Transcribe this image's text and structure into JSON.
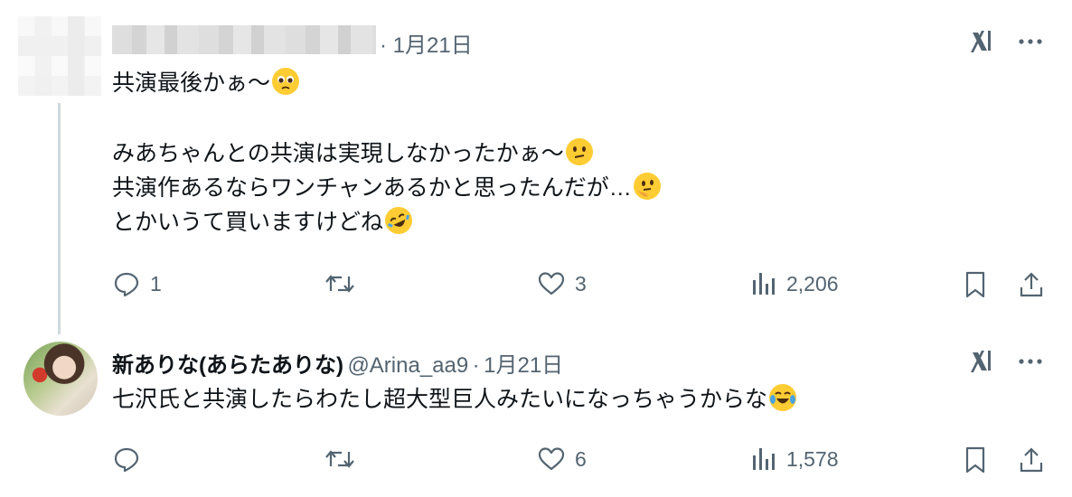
{
  "tweet1": {
    "dot": "·",
    "date": "1月21日",
    "lines": [
      "共演最後かぁ〜",
      "みあちゃんとの共演は実現しなかったかぁ〜",
      "共演作あるならワンチャンあるかと思ったんだが…",
      "とかいうて買いますけどね"
    ],
    "emojis": [
      "pleading-face",
      "face-with-diagonal-mouth",
      "thinking-face",
      "rolling-on-floor-laughing"
    ],
    "reply_count": "1",
    "retweet_count": "",
    "like_count": "3",
    "view_count": "2,206"
  },
  "tweet2": {
    "display_name": "新ありな(あらたありな)",
    "handle": "@Arina_aa9",
    "dot": "·",
    "date": "1月21日",
    "text": "七沢氏と共演したらわたし超大型巨人みたいになっちゃうからな",
    "emojis": [
      "face-with-tears-of-joy"
    ],
    "reply_count": "",
    "retweet_count": "",
    "like_count": "6",
    "view_count": "1,578"
  },
  "colors": {
    "text": "#0f1419",
    "muted": "#536471",
    "line": "#cfd9de",
    "emoji": "#ffcc33"
  }
}
